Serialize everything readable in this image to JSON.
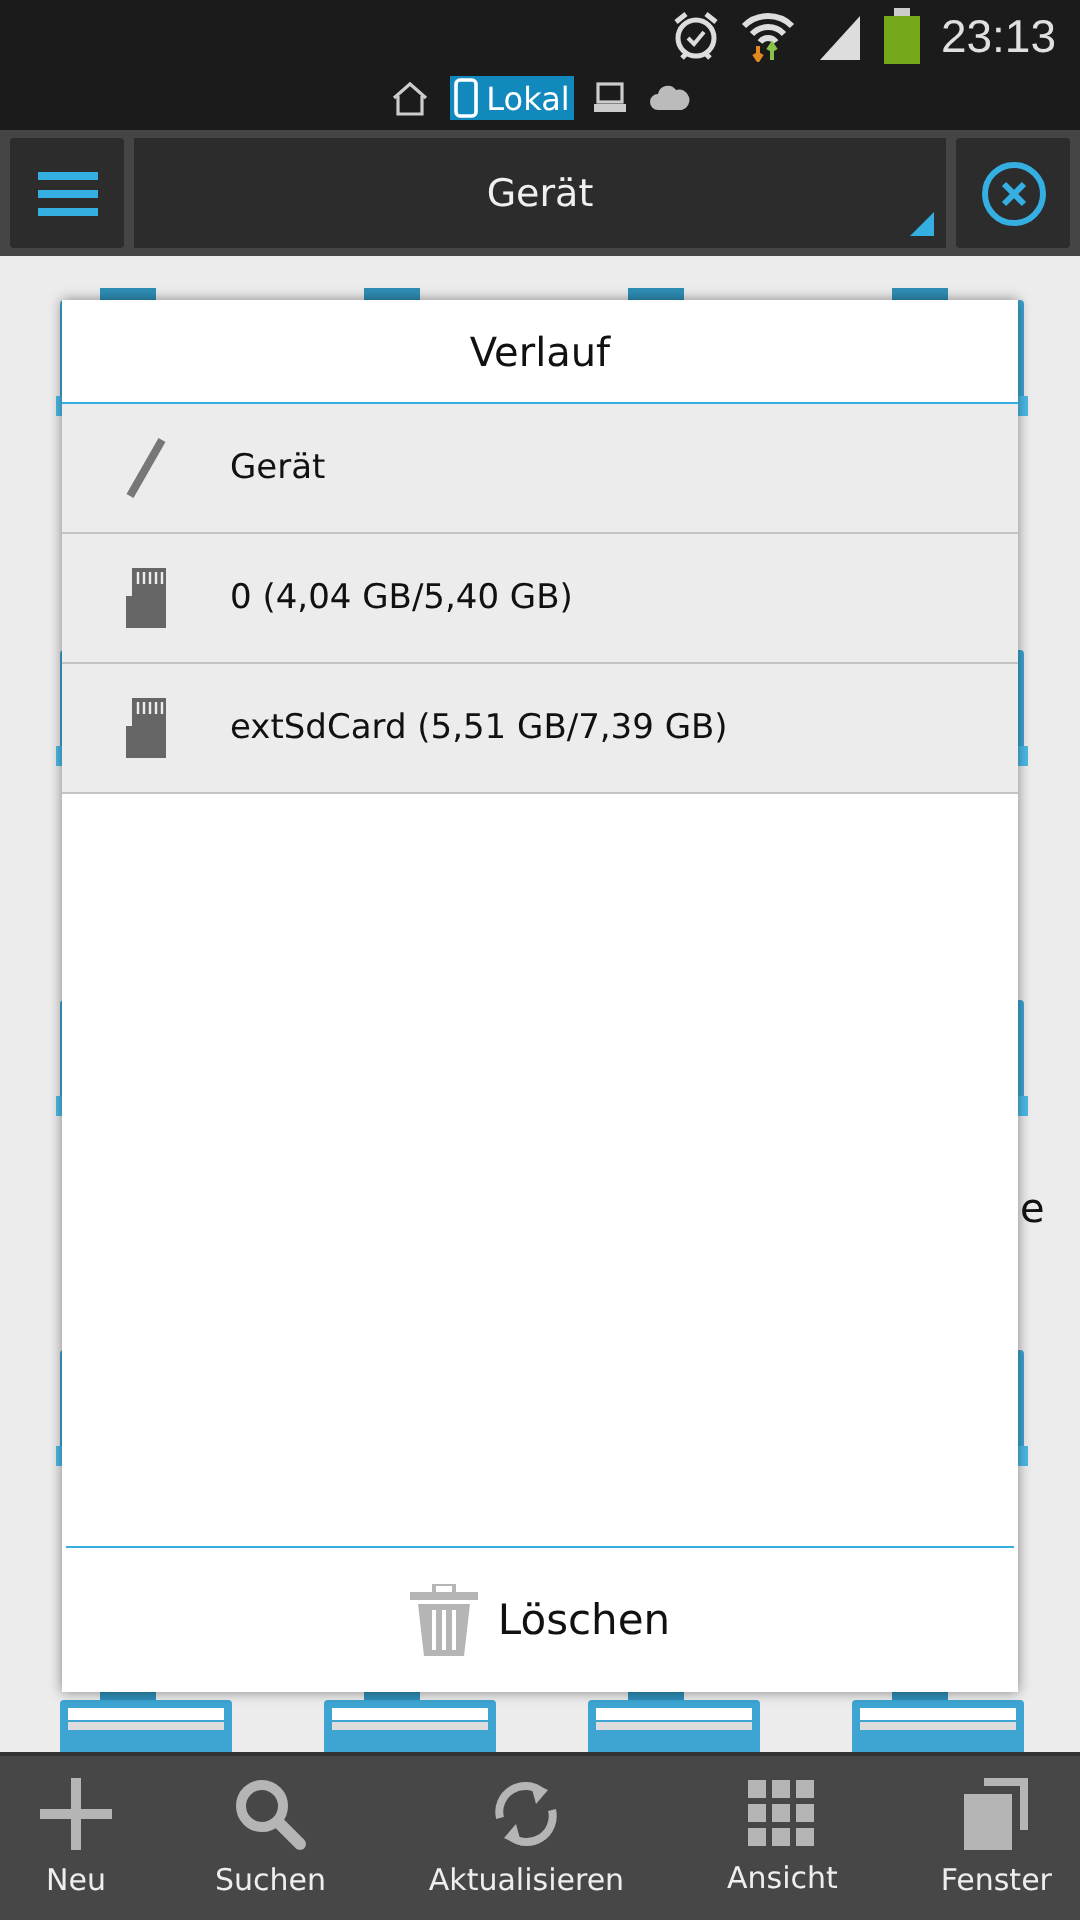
{
  "status_bar": {
    "time": "23:13"
  },
  "location_tabs": [
    {
      "kind": "home",
      "selected": false
    },
    {
      "kind": "device",
      "label": "Lokal",
      "selected": true
    },
    {
      "kind": "computer",
      "selected": false
    },
    {
      "kind": "cloud",
      "selected": false
    }
  ],
  "toolbar": {
    "path": "Gerät"
  },
  "background": {
    "label_fragment": "e"
  },
  "dialog": {
    "title": "Verlauf",
    "items": [
      {
        "kind": "root",
        "label": "Gerät"
      },
      {
        "kind": "card",
        "label": "0 (4,04 GB/5,40 GB)"
      },
      {
        "kind": "card",
        "label": "extSdCard (5,51 GB/7,39 GB)"
      }
    ],
    "action": "Löschen"
  },
  "bottom_bar": [
    {
      "kind": "new",
      "label": "Neu"
    },
    {
      "kind": "search",
      "label": "Suchen"
    },
    {
      "kind": "refresh",
      "label": "Aktualisieren"
    },
    {
      "kind": "view",
      "label": "Ansicht"
    },
    {
      "kind": "windows",
      "label": "Fenster"
    }
  ]
}
